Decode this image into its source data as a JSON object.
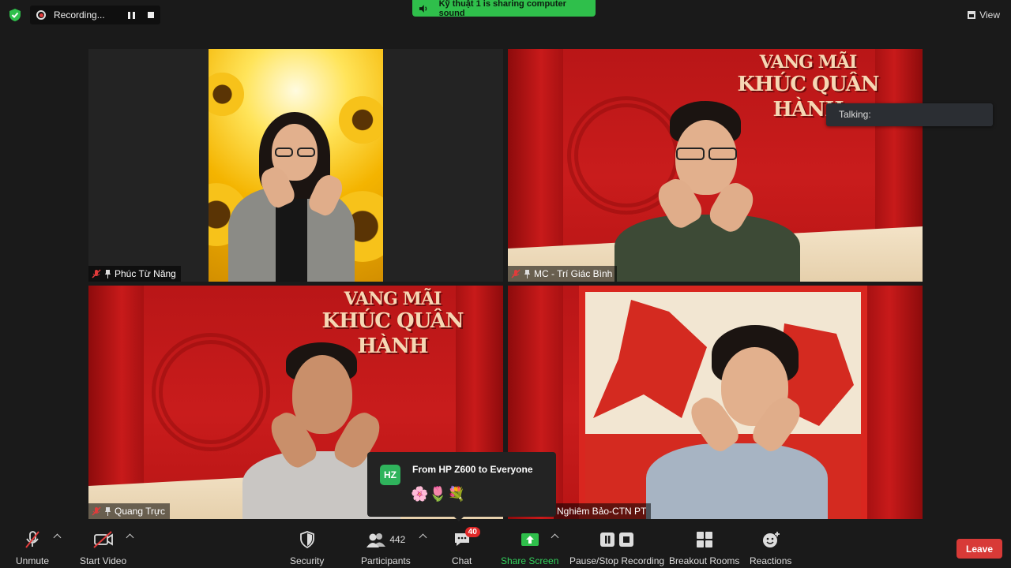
{
  "recording": {
    "label": "Recording..."
  },
  "banner": {
    "text": "Kỹ thuật 1 is sharing computer sound"
  },
  "view": {
    "label": "View"
  },
  "stage": {
    "line1": "VANG MÃI",
    "line2": "KHÚC QUÂN HÀNH"
  },
  "participants_tiles": [
    {
      "name": "Phúc Từ Năng"
    },
    {
      "name": "MC - Trí Giác Bình"
    },
    {
      "name": "Quang Trực"
    },
    {
      "name": "Nghiêm Bảo-CTN PT"
    }
  ],
  "talking": {
    "label": "Talking:"
  },
  "chat_popup": {
    "avatar": "HZ",
    "from": "From HP Z600 to Everyone",
    "message": "🌸🌷💐"
  },
  "toolbar": {
    "unmute": "Unmute",
    "start_video": "Start Video",
    "security": "Security",
    "participants": "Participants",
    "participants_count": "442",
    "chat": "Chat",
    "chat_badge": "40",
    "share_screen": "Share Screen",
    "recording": "Pause/Stop Recording",
    "breakout": "Breakout Rooms",
    "reactions": "Reactions",
    "leave": "Leave"
  },
  "colors": {
    "share_green": "#33d15c",
    "leave_red": "#d83a37",
    "banner_green": "#2fbf4b"
  }
}
